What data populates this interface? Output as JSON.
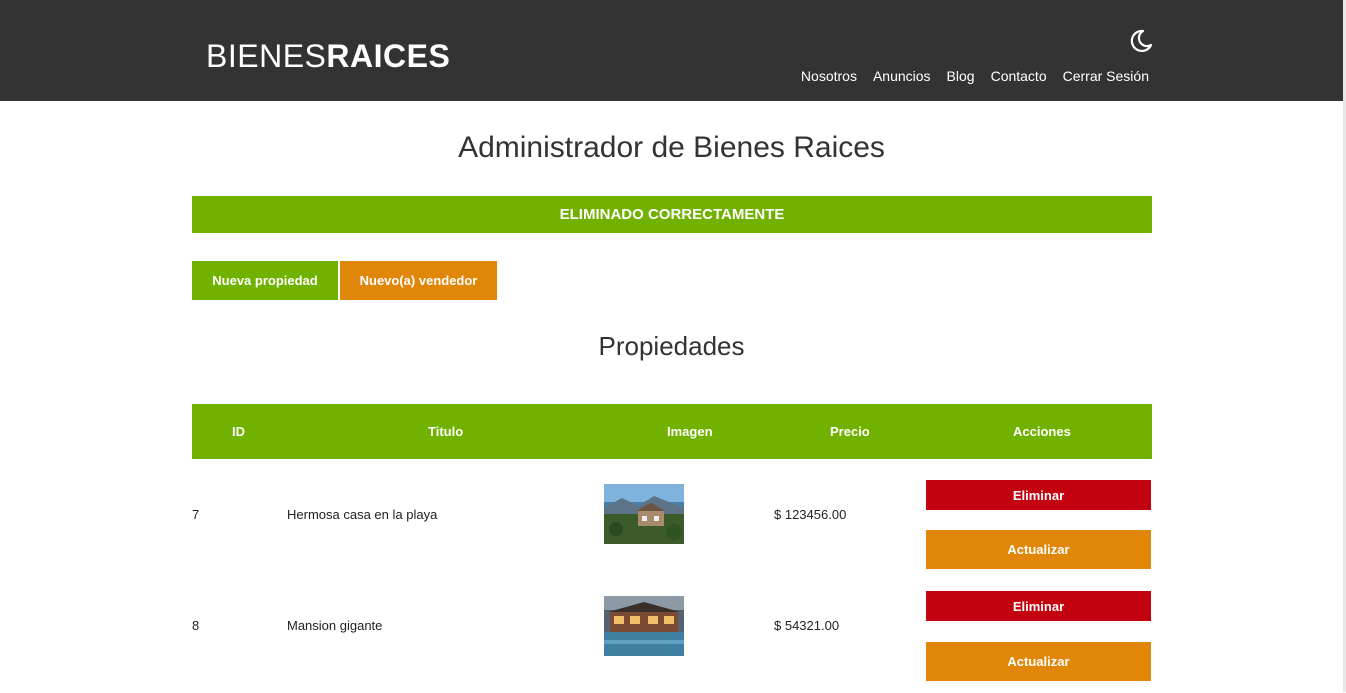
{
  "header": {
    "logo_light": "BIENES",
    "logo_bold": "RAICES",
    "nav": [
      "Nosotros",
      "Anuncios",
      "Blog",
      "Contacto",
      "Cerrar Sesión"
    ],
    "theme_icon": "moon-icon"
  },
  "main": {
    "title": "Administrador de Bienes Raices",
    "alert": "ELIMINADO CORRECTAMENTE",
    "new_property_label": "Nueva propiedad",
    "new_seller_label": "Nuevo(a) vendedor",
    "section_title": "Propiedades"
  },
  "table": {
    "headers": [
      "ID",
      "Titulo",
      "Imagen",
      "Precio",
      "Acciones"
    ],
    "rows": [
      {
        "id": "7",
        "title": "Hermosa casa en la playa",
        "price": "$ 123456.00",
        "delete": "Eliminar",
        "update": "Actualizar"
      },
      {
        "id": "8",
        "title": "Mansion gigante",
        "price": "$ 54321.00",
        "delete": "Eliminar",
        "update": "Actualizar"
      }
    ]
  },
  "colors": {
    "header_bg": "#333333",
    "green": "#71b100",
    "orange": "#e08709",
    "red": "#c40310"
  }
}
